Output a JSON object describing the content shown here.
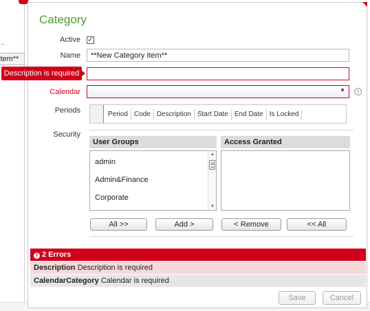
{
  "background": {
    "list_item_label": "item**"
  },
  "dialog": {
    "title": "Category",
    "fields": {
      "active_label": "Active",
      "active_checked": true,
      "name_label": "Name",
      "name_value": "**New Category Item**",
      "description_value": "",
      "calendar_label": "Calendar",
      "calendar_value": "",
      "periods_label": "Periods",
      "security_label": "Security"
    },
    "description_error_tooltip": "Description is required",
    "periods_columns": [
      "Period",
      "Code",
      "Description",
      "Start Date",
      "End Date",
      "Is Locked"
    ],
    "security": {
      "user_groups_header": "User Groups",
      "access_granted_header": "Access Granted",
      "user_groups": [
        "admin",
        "Admin&Finance",
        "Corporate"
      ],
      "access_granted": [],
      "buttons": {
        "all_add": "All >>",
        "add": "Add >",
        "remove": "< Remove",
        "all_remove": "<< All"
      }
    },
    "errors": {
      "header": "2 Errors",
      "items": [
        {
          "field": "Description",
          "message": "Description is required"
        },
        {
          "field": "CalendarCategory",
          "message": "Calendar is required"
        }
      ]
    },
    "footer": {
      "save": "Save",
      "cancel": "Cancel"
    }
  },
  "colors": {
    "error_red": "#d0021b",
    "title_green": "#4c9a2a"
  }
}
